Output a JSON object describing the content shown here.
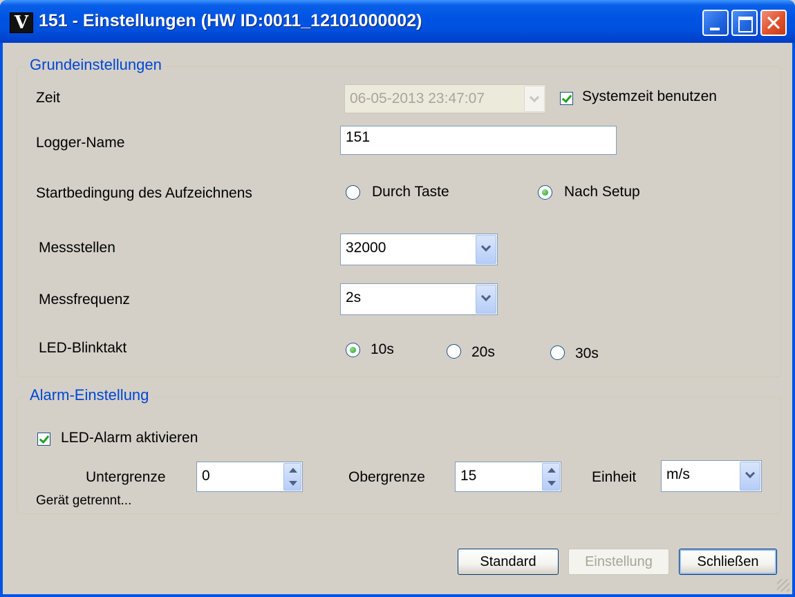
{
  "window": {
    "title": "151 - Einstellungen (HW ID:0011_12101000002)",
    "logo_letter": "V"
  },
  "grundeinstellungen": {
    "title": "Grundeinstellungen",
    "zeit": {
      "label": "Zeit",
      "value": "06-05-2013 23:47:07",
      "enabled": false
    },
    "systemzeit": {
      "label": "Systemzeit benutzen",
      "checked": true
    },
    "logger_name": {
      "label": "Logger-Name",
      "value": "151"
    },
    "startbedingung": {
      "label": "Startbedingung des Aufzeichnens",
      "options": [
        {
          "label": "Durch Taste",
          "selected": false
        },
        {
          "label": "Nach Setup",
          "selected": true
        }
      ]
    },
    "messstellen": {
      "label": "Messstellen",
      "value": "32000"
    },
    "messfrequenz": {
      "label": "Messfrequenz",
      "value": "2s"
    },
    "led_blinktakt": {
      "label": "LED-Blinktakt",
      "options": [
        {
          "label": "10s",
          "selected": true
        },
        {
          "label": "20s",
          "selected": false
        },
        {
          "label": "30s",
          "selected": false
        }
      ]
    }
  },
  "alarm": {
    "title": "Alarm-Einstellung",
    "led_alarm": {
      "label": "LED-Alarm aktivieren",
      "checked": true
    },
    "untergrenze": {
      "label": "Untergrenze",
      "value": "0"
    },
    "obergrenze": {
      "label": "Obergrenze",
      "value": "15"
    },
    "einheit": {
      "label": "Einheit",
      "value": "m/s"
    }
  },
  "status_text": "Gerät getrennt...",
  "buttons": {
    "standard": "Standard",
    "einstellung": "Einstellung",
    "schliessen": "Schließen"
  },
  "colors": {
    "titlebar": "#0054e3",
    "group_title": "#0046d5",
    "check_green": "#21a121"
  }
}
